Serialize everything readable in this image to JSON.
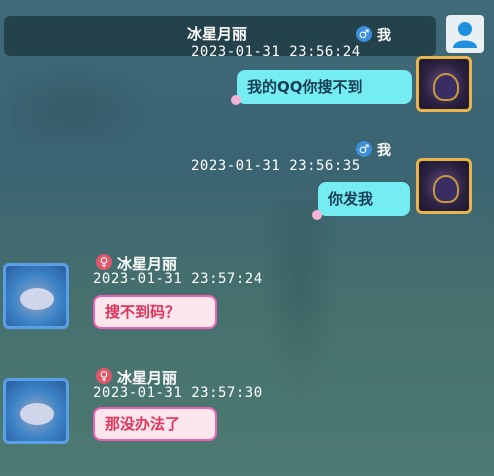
{
  "header": {
    "title": "冰星月丽",
    "gender_label": "我",
    "time": "2023-01-31  23:56:24"
  },
  "messages": [
    {
      "sender": "我",
      "time": "2023-01-31  23:56:24",
      "text": "我的QQ你搜不到"
    },
    {
      "sender": "我",
      "time": "2023-01-31  23:56:35",
      "text": "你发我"
    },
    {
      "sender": "冰星月丽",
      "time": "2023-01-31  23:57:24",
      "text": "搜不到码？"
    },
    {
      "sender": "冰星月丽",
      "time": "2023-01-31  23:57:30",
      "text": "那没办法了"
    }
  ],
  "colors": {
    "male_badge": "#3c8fd8",
    "female_badge": "#e0566a",
    "right_bubble": "#74ecf2",
    "left_bubble_border": "#ef5fb4"
  },
  "icons": {
    "profile": "person-icon",
    "male": "male-symbol",
    "female": "female-symbol"
  }
}
